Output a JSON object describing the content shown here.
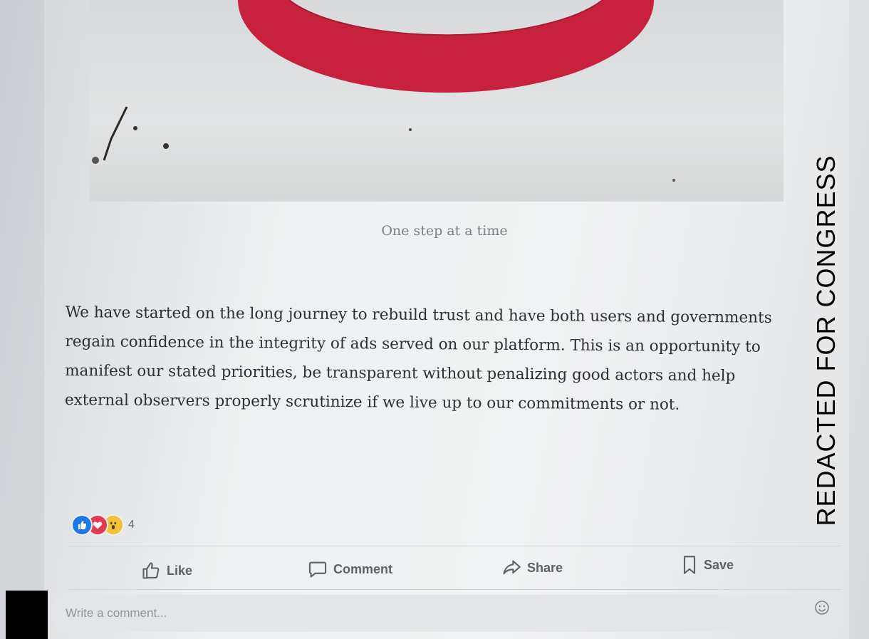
{
  "post": {
    "image_caption": "One step at a time",
    "body": "We have started on the long journey to rebuild trust and have both users and governments regain confidence in the integrity of ads served on our platform. This is an opportunity to manifest our stated priorities, be transparent without penalizing good actors and help external observers properly scrutinize if we live up to our commitments or not.",
    "reactions": {
      "icons": [
        "like-reaction-icon",
        "love-reaction-icon",
        "wow-reaction-icon"
      ],
      "count": "4"
    },
    "actions": {
      "like": "Like",
      "comment": "Comment",
      "share": "Share",
      "save": "Save"
    },
    "comment_input": {
      "placeholder": "Write a comment..."
    }
  },
  "overlay": {
    "redaction_label": "REDACTED FOR CONGRESS"
  },
  "colors": {
    "like_blue": "#1f78e5",
    "love_red": "#e53950",
    "wow_yellow": "#f3c23b",
    "photo_red": "#c8213d"
  }
}
